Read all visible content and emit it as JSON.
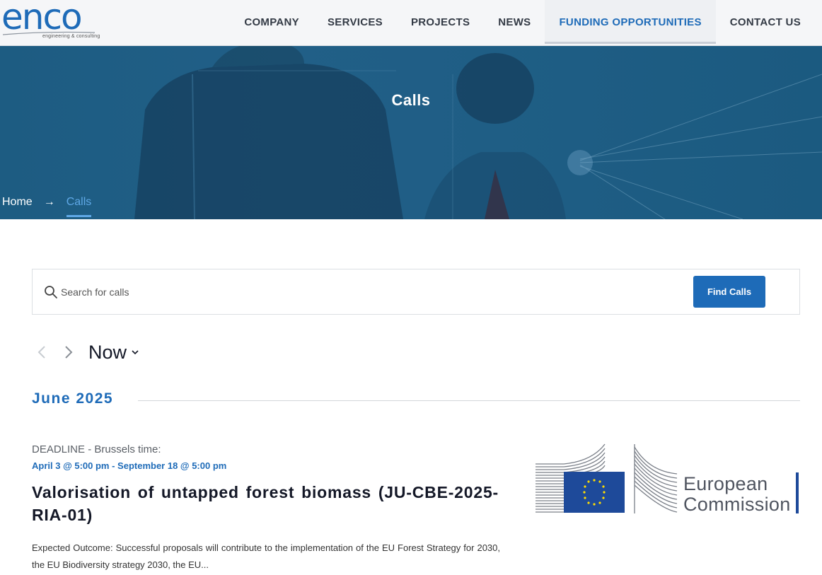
{
  "header": {
    "logo_text": "enco",
    "logo_subtitle": "engineering & consulting",
    "nav": [
      {
        "label": "COMPANY"
      },
      {
        "label": "SERVICES"
      },
      {
        "label": "PROJECTS"
      },
      {
        "label": "NEWS"
      },
      {
        "label": "FUNDING OPPORTUNITIES",
        "active": true
      },
      {
        "label": "CONTACT US"
      }
    ]
  },
  "hero": {
    "title": "Calls",
    "breadcrumb": {
      "home": "Home",
      "separator": "→",
      "current": "Calls"
    }
  },
  "search": {
    "placeholder": "Search for calls",
    "value": "",
    "button_label": "Find Calls",
    "icon": "search-icon"
  },
  "date_nav": {
    "prev_icon": "chevron-left-icon",
    "next_icon": "chevron-right-icon",
    "current_label": "Now",
    "caret_icon": "chevron-down-icon"
  },
  "month_heading": "June 2025",
  "events": [
    {
      "deadline_label": "DEADLINE - Brussels time:",
      "date_range": "April 3 @ 5:00 pm - September 18 @ 5:00 pm",
      "title": "Valorisation of untapped forest biomass (JU-CBE-2025-RIA-01)",
      "description": "Expected Outcome: Successful proposals will contribute to the implementation of the EU Forest Strategy for 2030, the EU Biodiversity strategy 2030, the EU...",
      "logo": {
        "line1": "European",
        "line2": "Commission"
      }
    }
  ],
  "colors": {
    "brand_blue": "#1e6bb8",
    "hero_bg": "#1f5e85",
    "text_dark": "#141827",
    "eu_blue": "#1e4a9a",
    "eu_yellow": "#ffdd00"
  }
}
